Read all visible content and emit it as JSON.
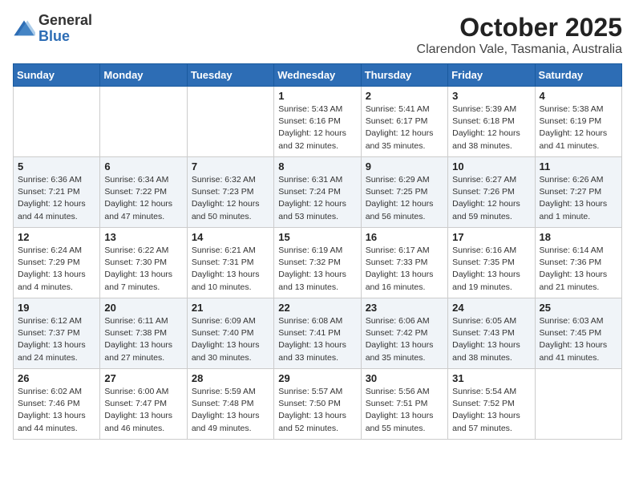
{
  "header": {
    "logo": {
      "line1": "General",
      "line2": "Blue"
    },
    "title": "October 2025",
    "subtitle": "Clarendon Vale, Tasmania, Australia"
  },
  "calendar": {
    "days_of_week": [
      "Sunday",
      "Monday",
      "Tuesday",
      "Wednesday",
      "Thursday",
      "Friday",
      "Saturday"
    ],
    "weeks": [
      [
        {
          "day": "",
          "info": ""
        },
        {
          "day": "",
          "info": ""
        },
        {
          "day": "",
          "info": ""
        },
        {
          "day": "1",
          "info": "Sunrise: 5:43 AM\nSunset: 6:16 PM\nDaylight: 12 hours\nand 32 minutes."
        },
        {
          "day": "2",
          "info": "Sunrise: 5:41 AM\nSunset: 6:17 PM\nDaylight: 12 hours\nand 35 minutes."
        },
        {
          "day": "3",
          "info": "Sunrise: 5:39 AM\nSunset: 6:18 PM\nDaylight: 12 hours\nand 38 minutes."
        },
        {
          "day": "4",
          "info": "Sunrise: 5:38 AM\nSunset: 6:19 PM\nDaylight: 12 hours\nand 41 minutes."
        }
      ],
      [
        {
          "day": "5",
          "info": "Sunrise: 6:36 AM\nSunset: 7:21 PM\nDaylight: 12 hours\nand 44 minutes."
        },
        {
          "day": "6",
          "info": "Sunrise: 6:34 AM\nSunset: 7:22 PM\nDaylight: 12 hours\nand 47 minutes."
        },
        {
          "day": "7",
          "info": "Sunrise: 6:32 AM\nSunset: 7:23 PM\nDaylight: 12 hours\nand 50 minutes."
        },
        {
          "day": "8",
          "info": "Sunrise: 6:31 AM\nSunset: 7:24 PM\nDaylight: 12 hours\nand 53 minutes."
        },
        {
          "day": "9",
          "info": "Sunrise: 6:29 AM\nSunset: 7:25 PM\nDaylight: 12 hours\nand 56 minutes."
        },
        {
          "day": "10",
          "info": "Sunrise: 6:27 AM\nSunset: 7:26 PM\nDaylight: 12 hours\nand 59 minutes."
        },
        {
          "day": "11",
          "info": "Sunrise: 6:26 AM\nSunset: 7:27 PM\nDaylight: 13 hours\nand 1 minute."
        }
      ],
      [
        {
          "day": "12",
          "info": "Sunrise: 6:24 AM\nSunset: 7:29 PM\nDaylight: 13 hours\nand 4 minutes."
        },
        {
          "day": "13",
          "info": "Sunrise: 6:22 AM\nSunset: 7:30 PM\nDaylight: 13 hours\nand 7 minutes."
        },
        {
          "day": "14",
          "info": "Sunrise: 6:21 AM\nSunset: 7:31 PM\nDaylight: 13 hours\nand 10 minutes."
        },
        {
          "day": "15",
          "info": "Sunrise: 6:19 AM\nSunset: 7:32 PM\nDaylight: 13 hours\nand 13 minutes."
        },
        {
          "day": "16",
          "info": "Sunrise: 6:17 AM\nSunset: 7:33 PM\nDaylight: 13 hours\nand 16 minutes."
        },
        {
          "day": "17",
          "info": "Sunrise: 6:16 AM\nSunset: 7:35 PM\nDaylight: 13 hours\nand 19 minutes."
        },
        {
          "day": "18",
          "info": "Sunrise: 6:14 AM\nSunset: 7:36 PM\nDaylight: 13 hours\nand 21 minutes."
        }
      ],
      [
        {
          "day": "19",
          "info": "Sunrise: 6:12 AM\nSunset: 7:37 PM\nDaylight: 13 hours\nand 24 minutes."
        },
        {
          "day": "20",
          "info": "Sunrise: 6:11 AM\nSunset: 7:38 PM\nDaylight: 13 hours\nand 27 minutes."
        },
        {
          "day": "21",
          "info": "Sunrise: 6:09 AM\nSunset: 7:40 PM\nDaylight: 13 hours\nand 30 minutes."
        },
        {
          "day": "22",
          "info": "Sunrise: 6:08 AM\nSunset: 7:41 PM\nDaylight: 13 hours\nand 33 minutes."
        },
        {
          "day": "23",
          "info": "Sunrise: 6:06 AM\nSunset: 7:42 PM\nDaylight: 13 hours\nand 35 minutes."
        },
        {
          "day": "24",
          "info": "Sunrise: 6:05 AM\nSunset: 7:43 PM\nDaylight: 13 hours\nand 38 minutes."
        },
        {
          "day": "25",
          "info": "Sunrise: 6:03 AM\nSunset: 7:45 PM\nDaylight: 13 hours\nand 41 minutes."
        }
      ],
      [
        {
          "day": "26",
          "info": "Sunrise: 6:02 AM\nSunset: 7:46 PM\nDaylight: 13 hours\nand 44 minutes."
        },
        {
          "day": "27",
          "info": "Sunrise: 6:00 AM\nSunset: 7:47 PM\nDaylight: 13 hours\nand 46 minutes."
        },
        {
          "day": "28",
          "info": "Sunrise: 5:59 AM\nSunset: 7:48 PM\nDaylight: 13 hours\nand 49 minutes."
        },
        {
          "day": "29",
          "info": "Sunrise: 5:57 AM\nSunset: 7:50 PM\nDaylight: 13 hours\nand 52 minutes."
        },
        {
          "day": "30",
          "info": "Sunrise: 5:56 AM\nSunset: 7:51 PM\nDaylight: 13 hours\nand 55 minutes."
        },
        {
          "day": "31",
          "info": "Sunrise: 5:54 AM\nSunset: 7:52 PM\nDaylight: 13 hours\nand 57 minutes."
        },
        {
          "day": "",
          "info": ""
        }
      ]
    ]
  }
}
